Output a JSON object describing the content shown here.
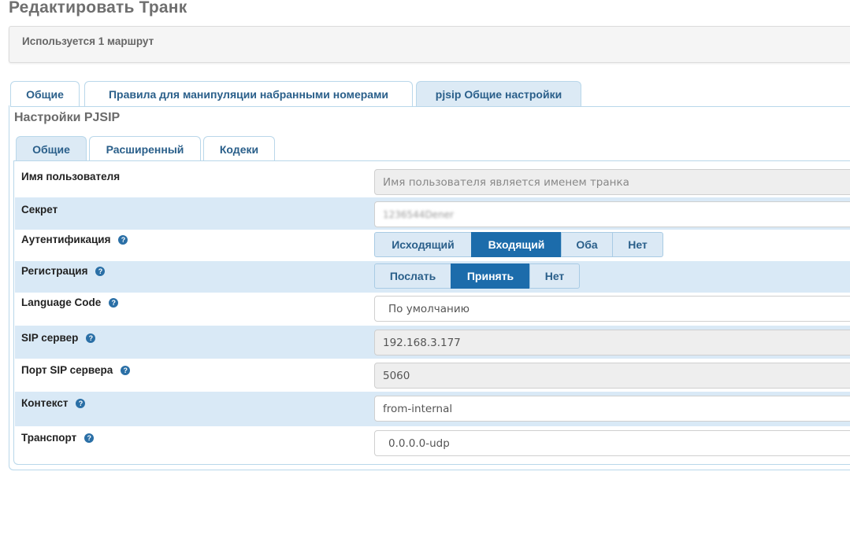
{
  "page": {
    "title": "Редактировать Транк"
  },
  "notice": {
    "text": "Используется 1 маршрут"
  },
  "outer_tabs": [
    {
      "label": "Общие",
      "active": false
    },
    {
      "label": "Правила для манипуляции набранными номерами",
      "active": false
    },
    {
      "label": "pjsip Общие настройки",
      "active": true
    }
  ],
  "section": {
    "title": "Настройки PJSIP"
  },
  "inner_tabs": [
    {
      "label": "Общие",
      "active": true
    },
    {
      "label": "Расширенный",
      "active": false
    },
    {
      "label": "Кодеки",
      "active": false
    }
  ],
  "help_glyph": "?",
  "form": {
    "username": {
      "label": "Имя пользователя",
      "placeholder": "Имя пользователя является именем транка"
    },
    "secret": {
      "label": "Секрет",
      "value": "1236544Dener"
    },
    "auth": {
      "label": "Аутентификация",
      "options": [
        "Исходящий",
        "Входящий",
        "Оба",
        "Нет"
      ],
      "selected": "Входящий"
    },
    "registration": {
      "label": "Регистрация",
      "options": [
        "Послать",
        "Принять",
        "Нет"
      ],
      "selected": "Принять"
    },
    "language": {
      "label": "Language Code",
      "value": "По умолчанию"
    },
    "sip_server": {
      "label": "SIP сервер",
      "value": "192.168.3.177"
    },
    "sip_port": {
      "label": "Порт SIP сервера",
      "value": "5060"
    },
    "context": {
      "label": "Контекст",
      "value": "from-internal"
    },
    "transport": {
      "label": "Транспорт",
      "value": "0.0.0.0-udp"
    }
  },
  "colors": {
    "accent": "#1c6cab",
    "tab_bg": "#dceaf5",
    "row_shade": "#d9e9f6"
  }
}
